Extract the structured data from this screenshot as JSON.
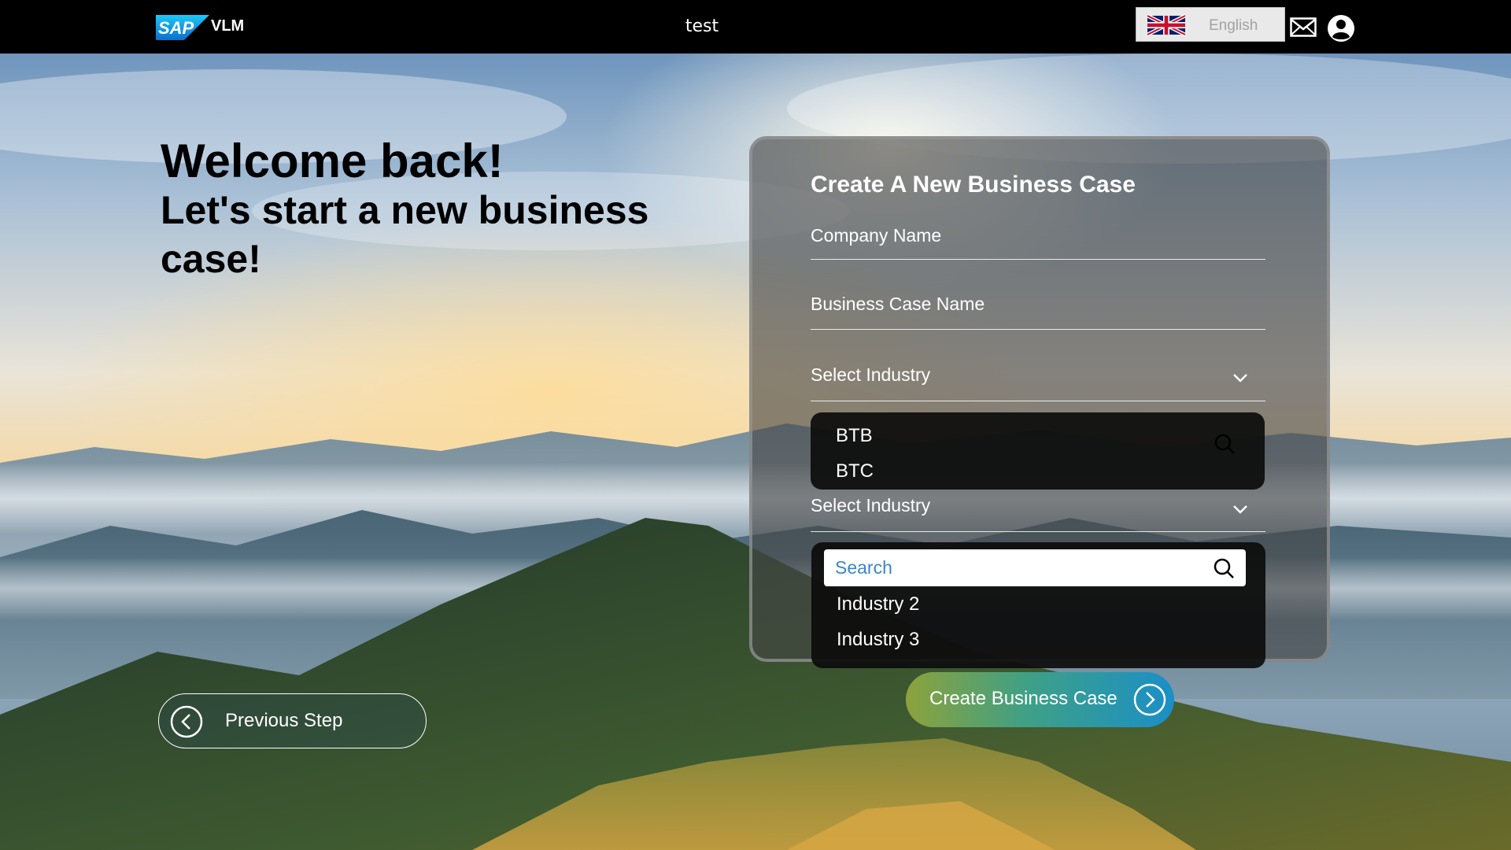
{
  "header": {
    "brand": "VLM",
    "title": "test",
    "language": "English",
    "icons": [
      "sap-logo",
      "uk-flag-icon",
      "mail-icon",
      "user-icon"
    ]
  },
  "welcome": {
    "heading": "Welcome back!",
    "subheading": "Let's start a new business case!"
  },
  "form": {
    "title": "Create A New Business Case",
    "company_name_label": "Company Name",
    "business_case_name_label": "Business Case Name",
    "industry_select_1": {
      "label": "Select Industry",
      "options": [
        "BTB",
        "BTC"
      ]
    },
    "industry_select_2": {
      "label": "Select Industry",
      "search_placeholder": "Search",
      "options": [
        "Industry 2",
        "Industry 3"
      ]
    }
  },
  "buttons": {
    "previous": "Previous Step",
    "create": "Create Business Case"
  },
  "colors": {
    "accent_blue": "#1a8fc7",
    "accent_green": "#8da23b",
    "search_placeholder": "#3a86c8"
  }
}
